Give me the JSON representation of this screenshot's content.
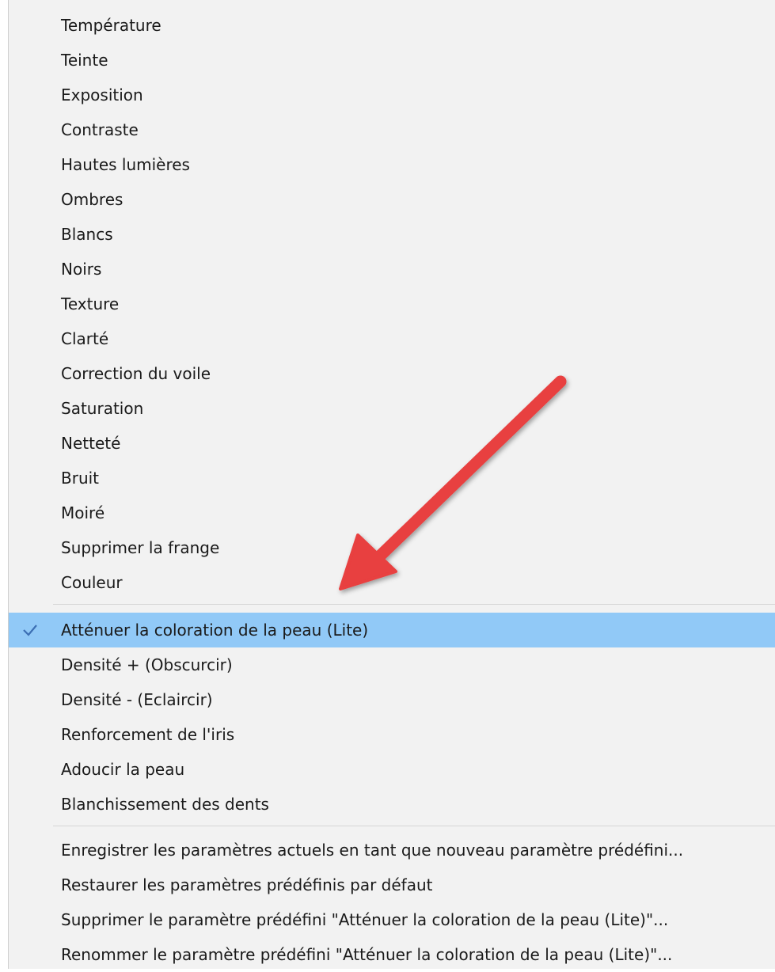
{
  "menu": {
    "group1": [
      "Température",
      "Teinte",
      "Exposition",
      "Contraste",
      "Hautes lumières",
      "Ombres",
      "Blancs",
      "Noirs",
      "Texture",
      "Clarté",
      "Correction du voile",
      "Saturation",
      "Netteté",
      "Bruit",
      "Moiré",
      "Supprimer la frange",
      "Couleur"
    ],
    "group2": [
      "Atténuer la coloration de la peau (Lite)",
      "Densité + (Obscurcir)",
      "Densité - (Eclaircir)",
      "Renforcement de l'iris",
      "Adoucir la peau",
      "Blanchissement des dents"
    ],
    "group3": [
      "Enregistrer les paramètres actuels en tant que nouveau paramètre prédéfini...",
      "Restaurer les paramètres prédéfinis par défaut",
      "Supprimer le paramètre prédéfini \"Atténuer la coloration de la peau (Lite)\"...",
      "Renommer le paramètre prédéfini \"Atténuer la coloration de la peau (Lite)\"..."
    ],
    "selected_label": "Atténuer la coloration de la peau (Lite)"
  },
  "colors": {
    "selection": "#91c9f7",
    "checkmark": "#3c6fb4",
    "annotation_arrow": "#e83f3f"
  },
  "icons": {
    "selected_indicator": "check-icon",
    "annotation": "red-arrow-annotation"
  }
}
